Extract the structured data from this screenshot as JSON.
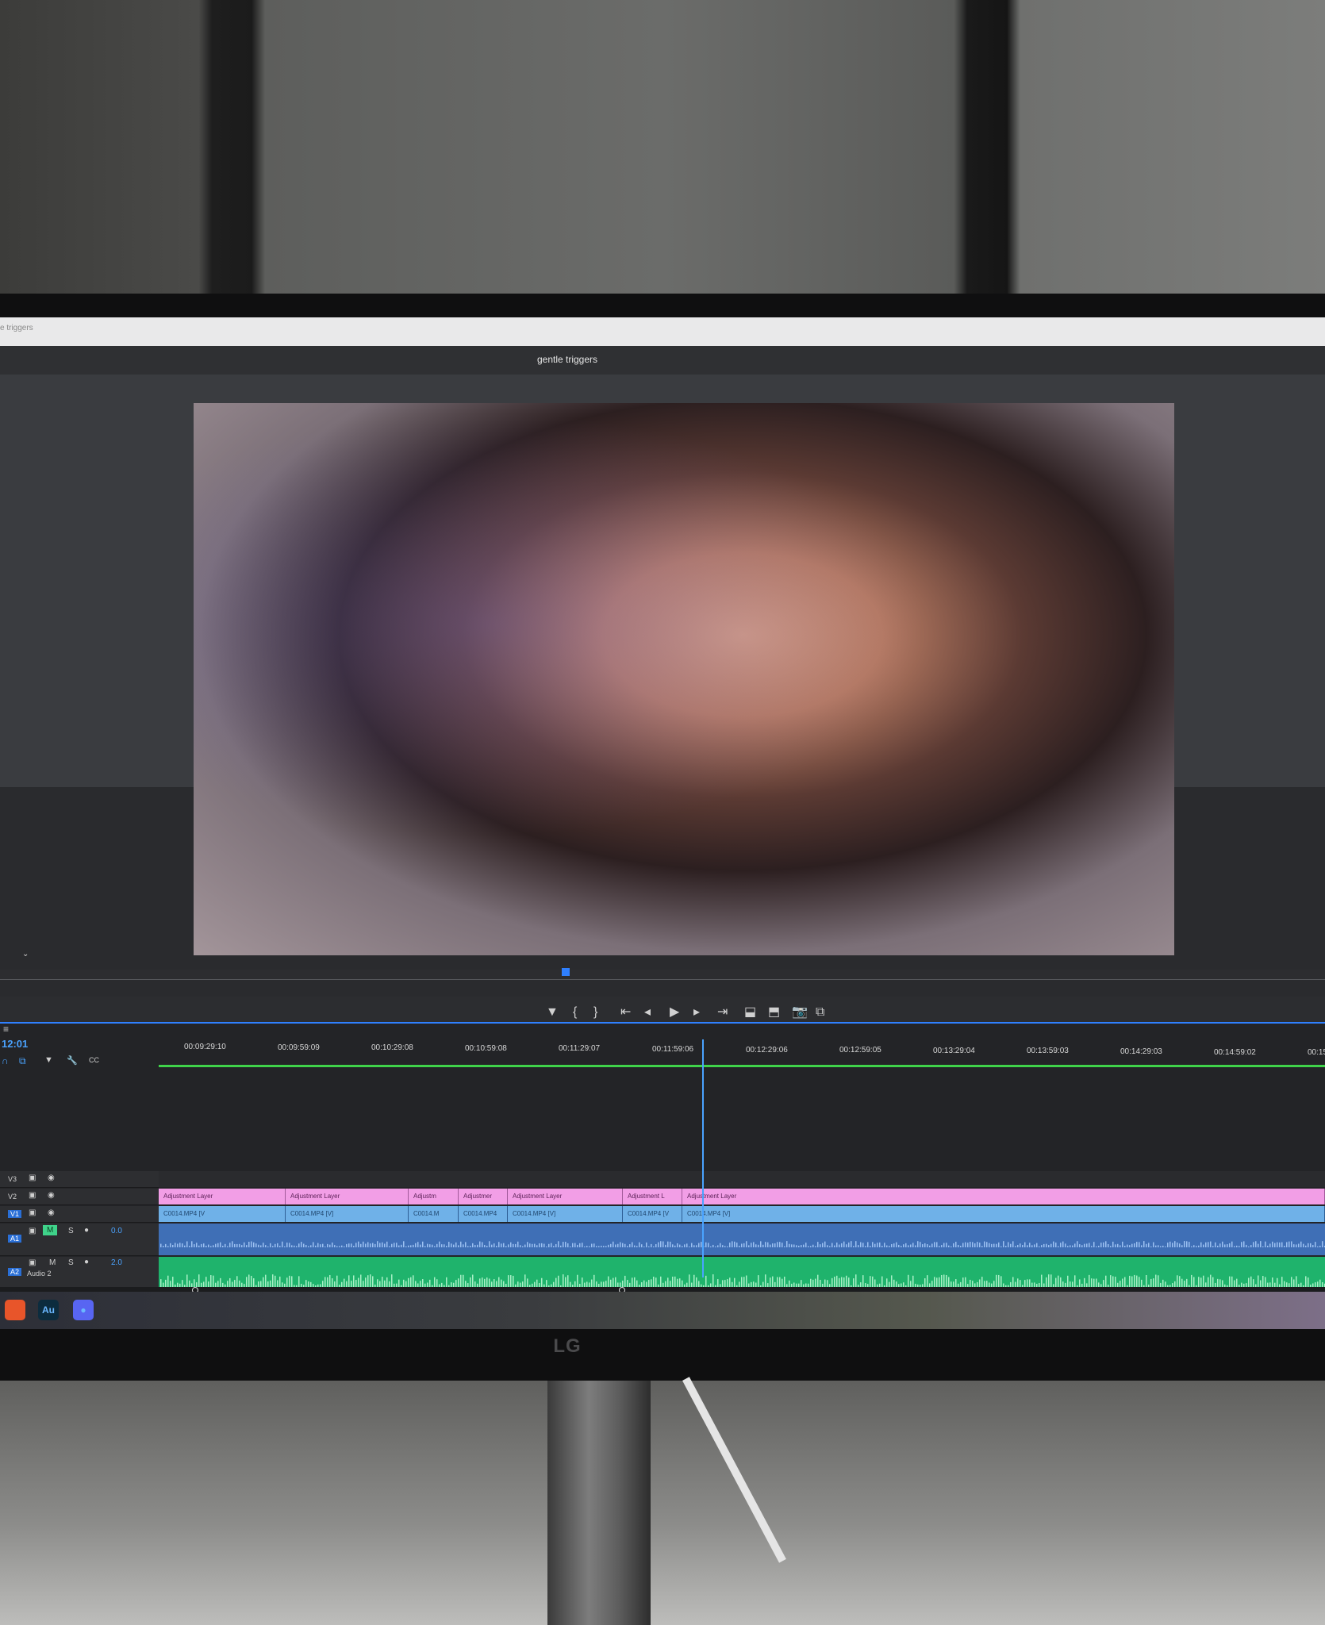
{
  "app": {
    "browser_tab": "e triggers",
    "sequence_title": "gentle triggers",
    "timecode": "12:01"
  },
  "monitor": {
    "brand_logo": "LG"
  },
  "program_monitor": {
    "dropdown_symbol": "⌄",
    "controls": [
      {
        "name": "marker-icon",
        "glyph": "▼"
      },
      {
        "name": "mark-in-icon",
        "glyph": "{"
      },
      {
        "name": "mark-out-icon",
        "glyph": "}"
      },
      {
        "name": "go-to-in-icon",
        "glyph": "⇤"
      },
      {
        "name": "step-back-icon",
        "glyph": "◂"
      },
      {
        "name": "play-icon",
        "glyph": "▶"
      },
      {
        "name": "step-forward-icon",
        "glyph": "▸"
      },
      {
        "name": "go-to-out-icon",
        "glyph": "⇥"
      },
      {
        "name": "lift-icon",
        "glyph": "⬓"
      },
      {
        "name": "extract-icon",
        "glyph": "⬒"
      },
      {
        "name": "export-frame-icon",
        "glyph": "📷"
      },
      {
        "name": "compare-icon",
        "glyph": "⧉"
      }
    ]
  },
  "timeline": {
    "ruler": [
      "00:09:29:10",
      "00:09:59:09",
      "00:10:29:08",
      "00:10:59:08",
      "00:11:29:07",
      "00:11:59:06",
      "00:12:29:06",
      "00:12:59:05",
      "00:13:29:04",
      "00:13:59:03",
      "00:14:29:03",
      "00:14:59:02",
      "00:15"
    ],
    "tracks": {
      "v3": "V3",
      "v2": "V2",
      "v1": "V1",
      "a1": "A1",
      "a2": "A2",
      "a2_name": "Audio 2",
      "a1_volume": "0.0",
      "a2_volume": "2.0",
      "mute": "M",
      "solo": "S"
    },
    "adjustment_clips": [
      "Adjustment Layer",
      "Adjustment Layer",
      "Adjustm",
      "Adjustmer",
      "Adjustment Layer",
      "Adjustment L",
      "Adjustment Layer"
    ],
    "video_clips": [
      "C0014.MP4 [V",
      "C0014.MP4 [V]",
      "C0014.M",
      "C0014.MP4",
      "C0014.MP4 [V]",
      "C0014.MP4 [V",
      "C0014.MP4 [V]"
    ]
  },
  "taskbar": {
    "apps": [
      {
        "name": "firefox-icon",
        "label": "",
        "color": "#e8552a"
      },
      {
        "name": "audition-icon",
        "label": "Au",
        "color": "#0c2c3e"
      },
      {
        "name": "discord-icon",
        "label": "●",
        "color": "#5865f2"
      }
    ]
  }
}
